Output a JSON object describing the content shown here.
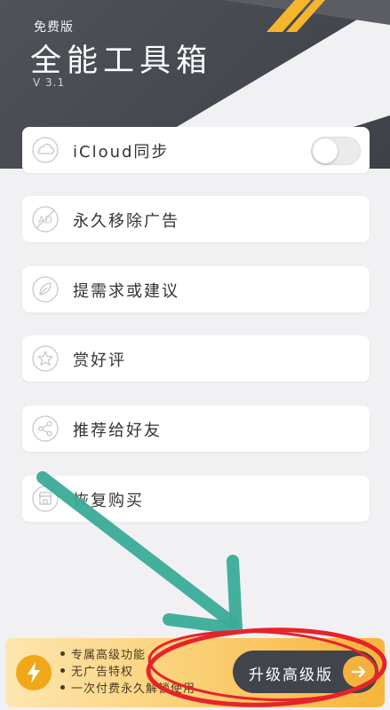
{
  "header": {
    "edition": "免费版",
    "title": "全能工具箱",
    "version": "V 3.1",
    "accent_color": "#f7b52c"
  },
  "menu": [
    {
      "label": "iCloud同步",
      "icon": "cloud-icon",
      "has_toggle": true,
      "toggle_on": false
    },
    {
      "label": "永久移除广告",
      "icon": "ad-icon"
    },
    {
      "label": "提需求或建议",
      "icon": "leaf-icon"
    },
    {
      "label": "赏好评",
      "icon": "star-icon"
    },
    {
      "label": "推荐给好友",
      "icon": "share-icon"
    },
    {
      "label": "恢复购买",
      "icon": "store-icon"
    }
  ],
  "promo": {
    "features": [
      "专属高级功能",
      "无广告特权",
      "一次付费永久解锁使用"
    ],
    "upgrade_label": "升级高级版",
    "icon": "lightning-icon"
  },
  "annotation": {
    "arrow_color": "#3aab98",
    "circle_color": "#e8222b"
  }
}
